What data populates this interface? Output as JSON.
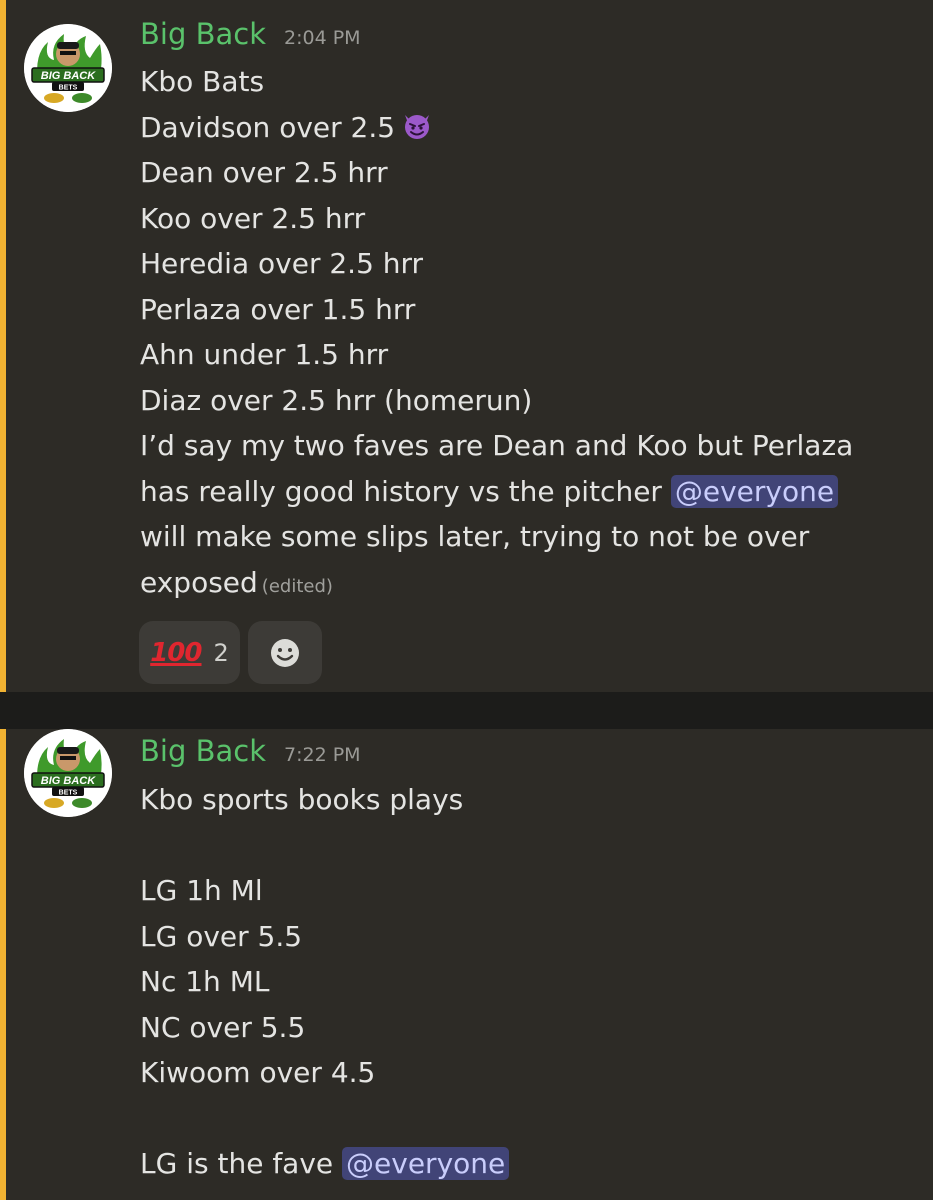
{
  "messages": [
    {
      "author": "Big Back",
      "time": "2:04 PM",
      "avatar_text": [
        "BIG BACK",
        "BETS"
      ],
      "lines": [
        "Kbo Bats",
        "Davidson over 2.5",
        "Dean over 2.5 hrr",
        "Koo over 2.5 hrr",
        "Heredia over 2.5 hrr",
        "Perlaza over 1.5 hrr",
        "Ahn under 1.5 hrr",
        "Diaz over 2.5 hrr (homerun)",
        "I’d say my two faves are Dean and Koo but Perlaza",
        "has really good history vs the pitcher ",
        "will make some slips later, trying to not be over",
        "exposed"
      ],
      "mention": "@everyone",
      "edited_label": "(edited)",
      "reactions": [
        {
          "emoji": "100",
          "icon": "hundred-points-icon",
          "count": "2"
        },
        {
          "icon": "add-reaction-smiley-icon"
        }
      ]
    },
    {
      "author": "Big Back",
      "time": "7:22 PM",
      "avatar_text": [
        "BIG BACK",
        "BETS"
      ],
      "lines": [
        "Kbo sports books plays",
        "",
        "LG 1h Ml",
        "LG over 5.5",
        "Nc 1h ML",
        "NC over 5.5",
        "Kiwoom over 4.5",
        "",
        "LG is the fave "
      ],
      "mention": "@everyone"
    }
  ],
  "colors": {
    "background": "#2d2b26",
    "mention_highlight": "#f0b232",
    "username": "#5ac26b",
    "mention_bg": "#414477",
    "mention_text": "#c9cdfb"
  }
}
